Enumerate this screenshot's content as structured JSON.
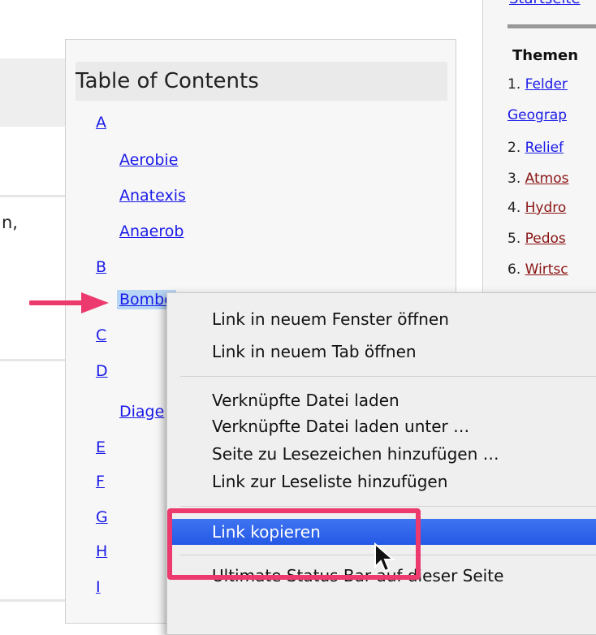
{
  "left": {
    "fragment": "n,"
  },
  "toc": {
    "title": "Table of Contents",
    "entries": [
      {
        "label": "A"
      },
      {
        "label": "Aerobie"
      },
      {
        "label": "Anatexis"
      },
      {
        "label": "Anaerob"
      },
      {
        "label": "B"
      },
      {
        "label": "Bombe"
      },
      {
        "label": "C"
      },
      {
        "label": "D"
      },
      {
        "label": "Diage"
      },
      {
        "label": "E"
      },
      {
        "label": "F"
      },
      {
        "label": "G"
      },
      {
        "label": "H"
      },
      {
        "label": "I"
      }
    ]
  },
  "sidebar": {
    "top_link": "Startseite",
    "heading": "Themen",
    "items": [
      {
        "num": "1.",
        "label": "Felder"
      },
      {
        "num": "",
        "label": "Geograp"
      },
      {
        "num": "2.",
        "label": "Relief"
      },
      {
        "num": "3.",
        "label": "Atmos"
      },
      {
        "num": "4.",
        "label": "Hydro"
      },
      {
        "num": "5.",
        "label": "Pedos"
      },
      {
        "num": "6.",
        "label": "Wirtsc"
      }
    ]
  },
  "context_menu": {
    "items": [
      "Link in neuem Fenster öffnen",
      "Link in neuem Tab öffnen",
      "Verknüpfte Datei laden",
      "Verknüpfte Datei laden unter …",
      "Seite zu Lesezeichen hinzufügen …",
      "Link zur Leseliste hinzufügen",
      "Link kopieren",
      "Ultimate Status Bar auf dieser Seite"
    ],
    "highlighted": "Link kopieren"
  },
  "colors": {
    "link": "#1a1ae8",
    "visited": "#8a1414",
    "highlight": "#2f66ec",
    "annotation": "#ec3a6e"
  }
}
